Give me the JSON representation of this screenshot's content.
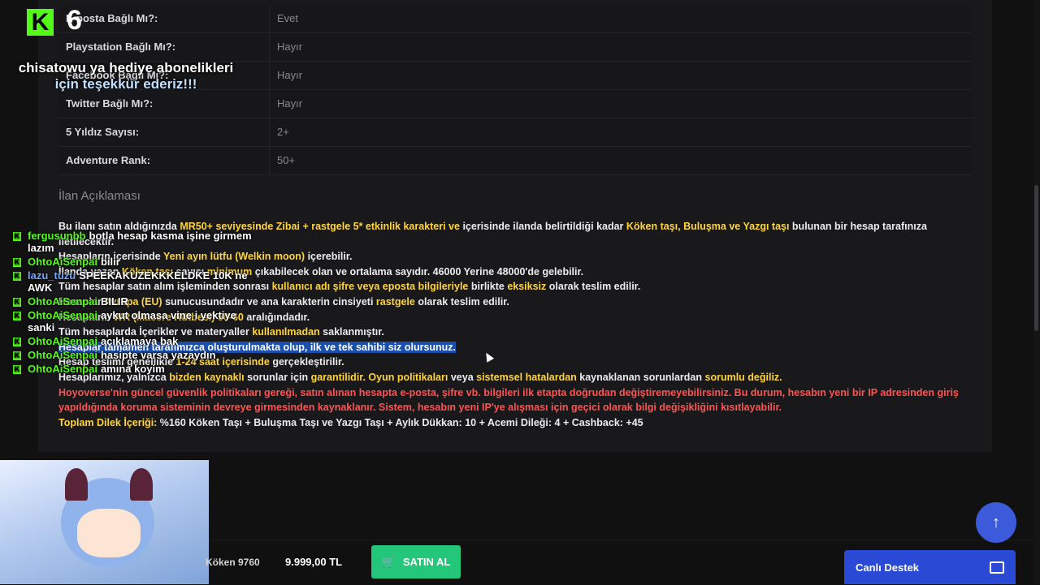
{
  "props": [
    {
      "key": "E-posta Bağlı Mı?:",
      "value": "Evet"
    },
    {
      "key": "Playstation Bağlı Mı?:",
      "value": "Hayır"
    },
    {
      "key": "Facebook Bağlı Mı?:",
      "value": "Hayır"
    },
    {
      "key": "Twitter Bağlı Mı?:",
      "value": "Hayır"
    },
    {
      "key": "5 Yıldız Sayısı:",
      "value": "2+"
    },
    {
      "key": "Adventure Rank:",
      "value": "50+"
    }
  ],
  "section_title": "İlan Açıklaması",
  "desc": {
    "l1a": "Bu ilanı satın aldığınızda ",
    "l1b": "MR50+ seviyesinde Zibai + rastgele 5* etkinlik karakteri ve",
    "l1c": " içerisinde ilanda belirtildiği kadar ",
    "l1d": "Köken taşı, Buluşma ve Yazgı taşı",
    "l1e": " bulunan bir hesap tarafınıza iletilecektir.",
    "l2a": "Hesapların içerisinde ",
    "l2b": "Yeni ayın lütfu (Welkin moon)",
    "l2c": " içerebilir.",
    "l3a": "İlanda yazan ",
    "l3b": "Köken taşı",
    "l3c": " sayısı ",
    "l3d": "minimum",
    "l3e": " çıkabilecek olan ve ortalama sayıdır. 46000 Yerine 48000'de gelebilir.",
    "l4a": "Tüm hesaplar satın alım işleminden sonrası ",
    "l4b": "kullanıcı adı şifre veya eposta bilgileriyle",
    "l4c": " birlikte ",
    "l4d": "eksiksiz",
    "l4e": " olarak teslim edilir.",
    "l5a": "Hesaplar ",
    "l5b": "Avrupa (EU)",
    "l5c": " sunucusundadır ve ana karakterin cinsiyeti ",
    "l5d": "rastgele",
    "l5e": " olarak teslim edilir.",
    "l6a": "Hesapların ",
    "l6b": "WR (Macere Rütbesi) 50-60",
    "l6c": " aralığındadır.",
    "l7a": "Tüm hesaplarda İçerikler ve materyaller ",
    "l7b": "kullanılmadan",
    "l7c": " saklanmıştır.",
    "l8": "Hesaplar tamamen tarafımızca oluşturulmakta olup, ilk ve tek sahibi siz olursunuz.",
    "l9a": "Hesap teslimi genellikle ",
    "l9b": "1-24 saat içerisinde",
    "l9c": " gerçekleştirilir.",
    "l10a": "Hesaplarımız, yalnızca ",
    "l10b": "bizden kaynaklı",
    "l10c": " sorunlar için ",
    "l10d": "garantilidir. Oyun politikaları",
    "l10e": " veya ",
    "l10f": "sistemsel hatalardan",
    "l10g": " kaynaklanan sorunlardan ",
    "l10h": "sorumlu değiliz.",
    "l11": "Hoyoverse'nin güncel güvenlik politikaları gereği, satın alınan hesapta e-posta, şifre vb. bilgileri ilk etapta doğrudan değiştiremeyebilirsiniz. Bu durum, hesabın yeni bir IP adresinden giriş yapıldığında koruma sisteminin devreye girmesinden kaynaklanır. Sistem, hesabın yeni IP'ye alışması için geçici olarak bilgi değişikliğini kısıtlayabilir.",
    "l12a": "Toplam Dilek İçeriği:",
    "l12b": " %160 Köken Taşı + Buluşma Taşı ve Yazgı Taşı + Aylık Dükkan: 10 + Acemi Dileği: 4 + Cashback: +45"
  },
  "overlay": {
    "sub_count": "6",
    "thanks_l1": "chisatowu ya hediye abonelikleri",
    "thanks_l2": "için teşekkür ederiz!!!",
    "chat": [
      {
        "user": "fergusunbb",
        "msg": "botla hesap kasma işine girmem lazım"
      },
      {
        "user": "OhtoAiSenpai",
        "msg": "bilir"
      },
      {
        "user": "lazu_tuzu",
        "msg": "SPEEKAKUZEKKKELDKE 10K ne AWK"
      },
      {
        "user": "OhtoAiSenpai",
        "msg": "BILIR"
      },
      {
        "user": "OhtoAiSenpai",
        "msg": "aykut olmasa vine i yektiye sanki"
      },
      {
        "user": "OhtoAiSenpai",
        "msg": "açıklamaya bak"
      },
      {
        "user": "OhtoAiSenpai",
        "msg": "hasipte varsa yazaydın"
      },
      {
        "user": "OhtoAiSenpai",
        "msg": "amına koyim"
      }
    ]
  },
  "bottom": {
    "coin": "Köken 9760",
    "price": "9.999,00 TL",
    "buy_label": "SATIN AL",
    "support_label": "Canlı Destek"
  }
}
